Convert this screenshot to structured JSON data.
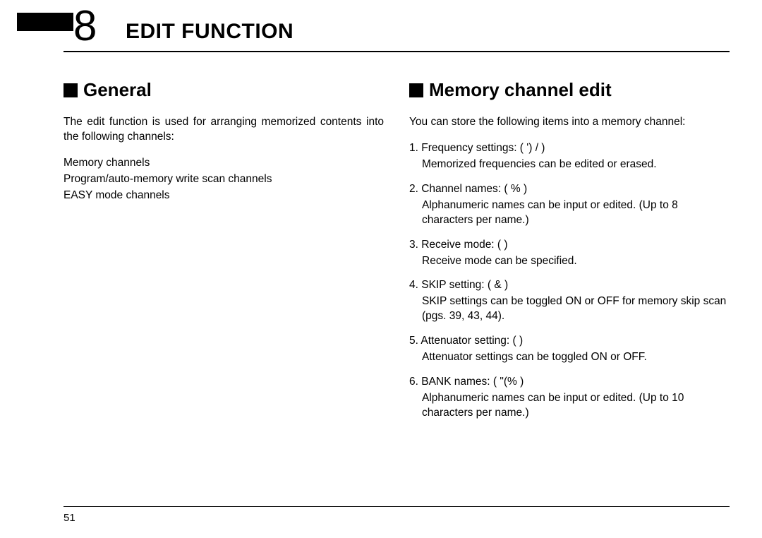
{
  "chapter": {
    "number": "8",
    "title": "EDIT FUNCTION"
  },
  "left": {
    "heading": "General",
    "intro": "The edit function is used for arranging memorized contents into the following channels:",
    "lines": {
      "a": "Memory channels",
      "b": "Program/auto-memory write scan channels",
      "c": "EASY mode channels"
    }
  },
  "right": {
    "heading": "Memory channel edit",
    "intro": "You can store the following items into a memory channel:",
    "items": {
      "i1": {
        "head": "1. Frequency settings: (     ') /            )",
        "body": "Memorized frequencies can be edited or erased."
      },
      "i2": {
        "head": "2. Channel names: (       %               )",
        "body": "Alphanumeric names can be input or edited. (Up to 8 characters per name.)"
      },
      "i3": {
        "head": "3. Receive mode: (                 )",
        "body": "Receive mode can be specified."
      },
      "i4": {
        "head": "4. SKIP setting: (     &            )",
        "body": "SKIP settings can be toggled ON or OFF for memory skip scan (pgs. 39, 43, 44)."
      },
      "i5": {
        "head": "5. Attenuator setting: (                 )",
        "body": "Attenuator settings can be toggled ON or OFF."
      },
      "i6": {
        "head": "6. BANK names: (    \"(%               )",
        "body": "Alphanumeric names can be input or edited. (Up to 10 characters per name.)"
      }
    }
  },
  "page_number": "51"
}
